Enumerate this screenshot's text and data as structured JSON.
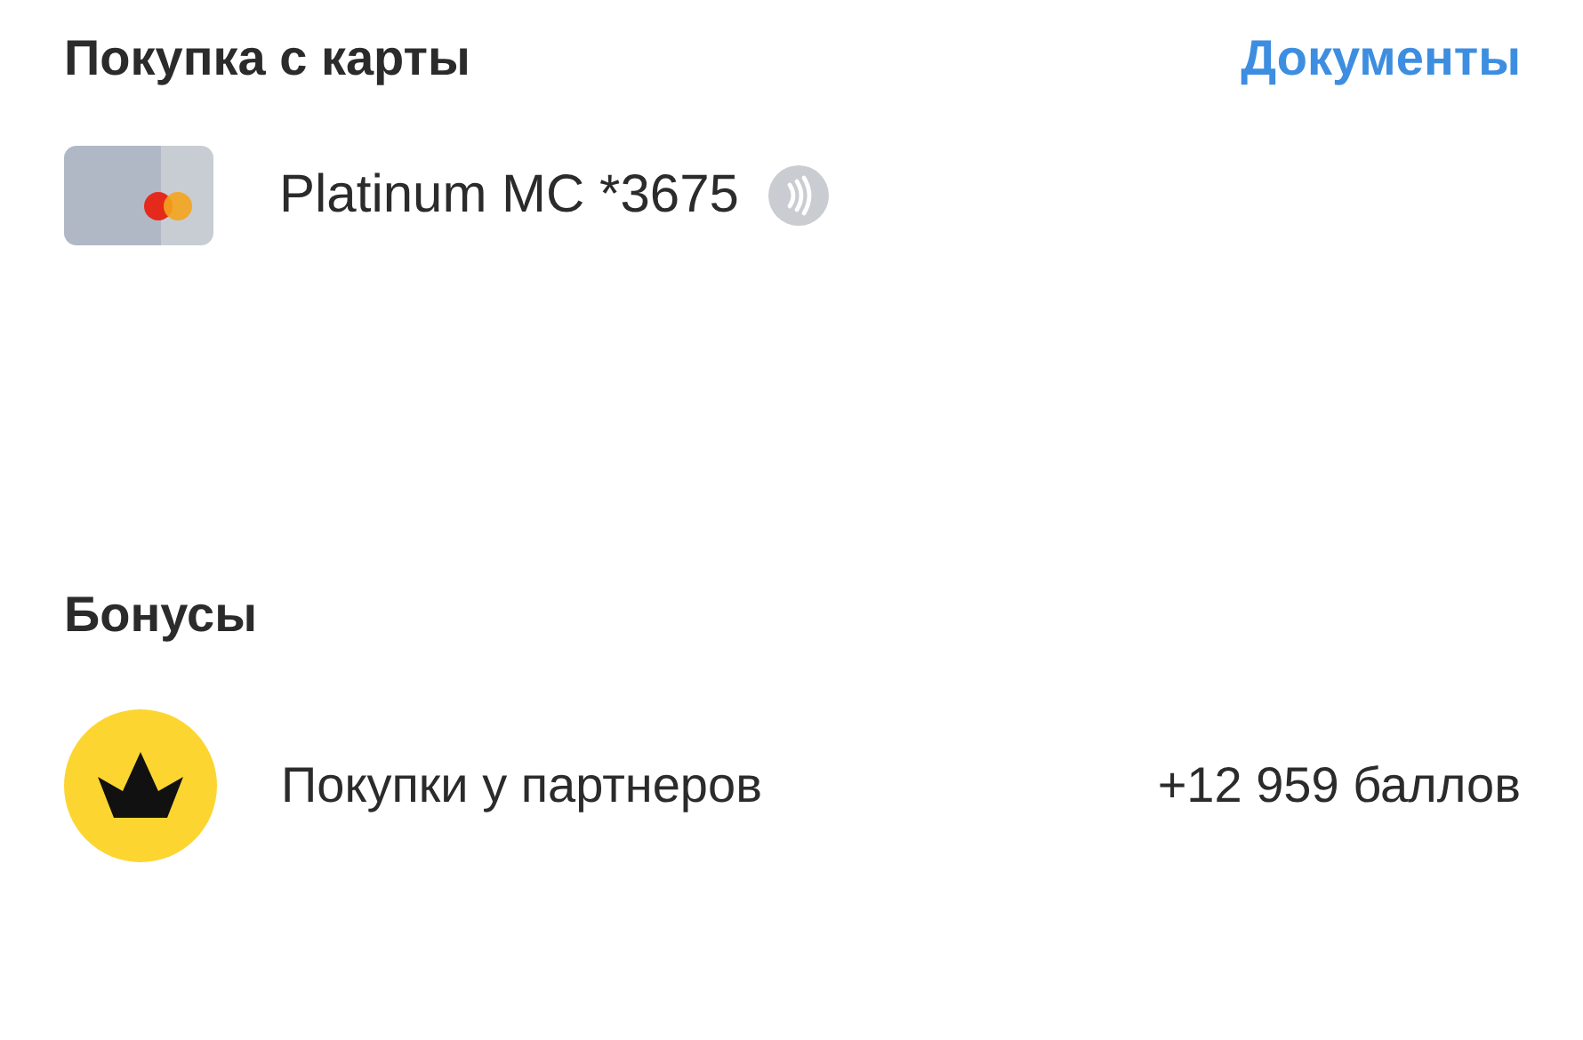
{
  "purchase": {
    "title": "Покупка с карты",
    "link": "Документы",
    "card": {
      "name": "Platinum MC *3675",
      "contactless": true
    }
  },
  "bonuses": {
    "title": "Бонусы",
    "items": [
      {
        "label": "Покупки у партнеров",
        "amount": "+12 959 баллов"
      }
    ]
  }
}
